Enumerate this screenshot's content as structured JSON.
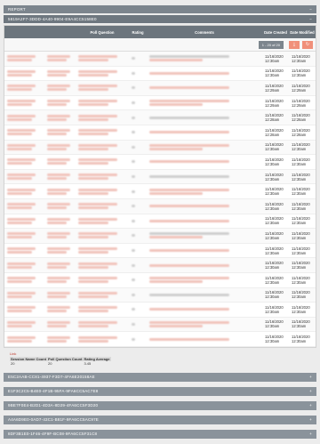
{
  "report_bar": {
    "title": "REPORT",
    "toggle": "−"
  },
  "session_bar": {
    "title": "5819A2F7-3DDD-4A40-9904-E9A4CC5158E0",
    "toggle": "−"
  },
  "table": {
    "columns": [
      "",
      "",
      "Poll Question",
      "Rating",
      "Comments",
      "Date Created",
      "Date Modified"
    ],
    "pager": "1 - 20 of 20",
    "rows": [
      {
        "created_date": "11/16/2020",
        "created_time": "12:30am",
        "modified_date": "11/16/2020",
        "modified_time": "12:30am"
      },
      {
        "created_date": "11/16/2020",
        "created_time": "12:30am",
        "modified_date": "11/16/2020",
        "modified_time": "12:30am"
      },
      {
        "created_date": "11/16/2020",
        "created_time": "12:29am",
        "modified_date": "11/16/2020",
        "modified_time": "12:29am"
      },
      {
        "created_date": "11/16/2020",
        "created_time": "12:29am",
        "modified_date": "11/16/2020",
        "modified_time": "12:29am"
      },
      {
        "created_date": "11/16/2020",
        "created_time": "12:28am",
        "modified_date": "11/16/2020",
        "modified_time": "12:28am"
      },
      {
        "created_date": "11/16/2020",
        "created_time": "12:28am",
        "modified_date": "11/16/2020",
        "modified_time": "12:28am"
      },
      {
        "created_date": "11/16/2020",
        "created_time": "12:30am",
        "modified_date": "11/16/2020",
        "modified_time": "12:30am"
      },
      {
        "created_date": "11/16/2020",
        "created_time": "12:30am",
        "modified_date": "11/16/2020",
        "modified_time": "12:30am"
      },
      {
        "created_date": "11/16/2020",
        "created_time": "12:30am",
        "modified_date": "11/16/2020",
        "modified_time": "12:30am"
      },
      {
        "created_date": "11/16/2020",
        "created_time": "12:30am",
        "modified_date": "11/16/2020",
        "modified_time": "12:30am"
      },
      {
        "created_date": "11/16/2020",
        "created_time": "12:30am",
        "modified_date": "11/16/2020",
        "modified_time": "12:30am"
      },
      {
        "created_date": "11/16/2020",
        "created_time": "12:30am",
        "modified_date": "11/16/2020",
        "modified_time": "12:30am"
      },
      {
        "created_date": "11/16/2020",
        "created_time": "12:30am",
        "modified_date": "11/16/2020",
        "modified_time": "12:30am"
      },
      {
        "created_date": "11/16/2020",
        "created_time": "12:30am",
        "modified_date": "11/16/2020",
        "modified_time": "12:30am"
      },
      {
        "created_date": "11/16/2020",
        "created_time": "12:30am",
        "modified_date": "11/16/2020",
        "modified_time": "12:30am"
      },
      {
        "created_date": "11/16/2020",
        "created_time": "12:30am",
        "modified_date": "11/16/2020",
        "modified_time": "12:30am"
      },
      {
        "created_date": "11/16/2020",
        "created_time": "12:30am",
        "modified_date": "11/16/2020",
        "modified_time": "12:30am"
      },
      {
        "created_date": "11/16/2020",
        "created_time": "12:30am",
        "modified_date": "11/16/2020",
        "modified_time": "12:30am"
      },
      {
        "created_date": "11/16/2020",
        "created_time": "12:30am",
        "modified_date": "11/16/2020",
        "modified_time": "12:30am"
      },
      {
        "created_date": "11/16/2020",
        "created_time": "12:30am",
        "modified_date": "11/16/2020",
        "modified_time": "12:30am"
      }
    ]
  },
  "summary": {
    "link": "Link",
    "headers": [
      "Session Name Count",
      "Poll Question Count",
      "Rating Average"
    ],
    "values": [
      "20",
      "20",
      "3.45"
    ]
  },
  "other_sessions": [
    {
      "title": "E5C2AAB-CC81-4937-F3D7-4FA6E20158AE",
      "toggle": "+"
    },
    {
      "title": "E1F3C2C5-B4E0-4F1B-95FA-9FA6CC5AC7E8",
      "toggle": "+"
    },
    {
      "title": "9BE7F0E4-B2D1-4D3A-8D29-4FA6CC5F3D20",
      "toggle": "+"
    },
    {
      "title": "A4A6D9E0-0AD7-43C1-B81F-9FA6CC5AC97E",
      "toggle": "+"
    },
    {
      "title": "8DF3B1E0-1F46-4F9F-BC08-9FA6CC5F31C8",
      "toggle": "+"
    }
  ],
  "colors": {
    "header": "#7c858d",
    "accent": "#f0907a",
    "blur_red": "#f1c4bc"
  }
}
